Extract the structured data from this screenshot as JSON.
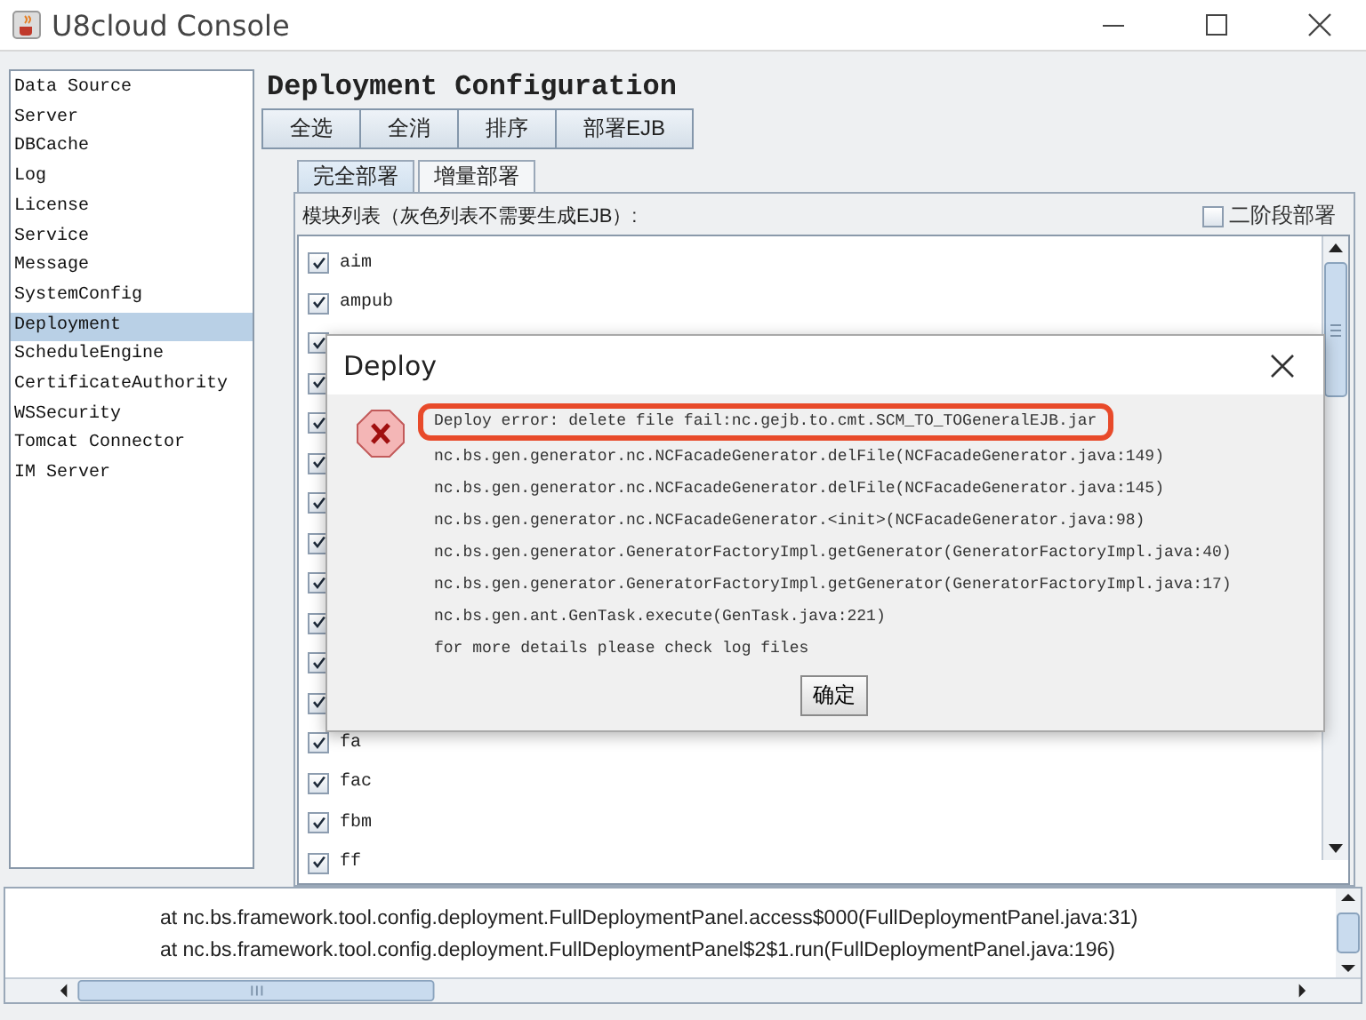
{
  "window": {
    "title": "U8cloud Console"
  },
  "sidebar": {
    "items": [
      {
        "label": "Data Source",
        "selected": false
      },
      {
        "label": "Server",
        "selected": false
      },
      {
        "label": "DBCache",
        "selected": false
      },
      {
        "label": "Log",
        "selected": false
      },
      {
        "label": "License",
        "selected": false
      },
      {
        "label": "Service",
        "selected": false
      },
      {
        "label": "Message",
        "selected": false
      },
      {
        "label": "SystemConfig",
        "selected": false
      },
      {
        "label": "Deployment",
        "selected": true
      },
      {
        "label": "ScheduleEngine",
        "selected": false
      },
      {
        "label": "CertificateAuthority",
        "selected": false
      },
      {
        "label": "WSSecurity",
        "selected": false
      },
      {
        "label": "Tomcat Connector",
        "selected": false
      },
      {
        "label": "IM Server",
        "selected": false
      }
    ]
  },
  "heading": "Deployment Configuration",
  "toolbar": [
    "全选",
    "全消",
    "排序",
    "部署EJB"
  ],
  "tabs": [
    {
      "label": "完全部署",
      "selected": true
    },
    {
      "label": "增量部署",
      "selected": false
    }
  ],
  "module_list": {
    "label": "模块列表（灰色列表不需要生成EJB）:",
    "two_stage": {
      "label": "二阶段部署",
      "checked": false
    },
    "modules": [
      {
        "name": "aim",
        "checked": true
      },
      {
        "name": "ampub",
        "checked": true
      },
      {
        "checked": true
      },
      {
        "checked": true
      },
      {
        "checked": true
      },
      {
        "checked": true
      },
      {
        "checked": true
      },
      {
        "checked": true
      },
      {
        "checked": true
      },
      {
        "checked": true
      },
      {
        "checked": true
      },
      {
        "checked": true
      },
      {
        "name": "fa",
        "checked": true
      },
      {
        "name": "fac",
        "checked": true
      },
      {
        "name": "fbm",
        "checked": true
      },
      {
        "name": "ff",
        "checked": true
      }
    ]
  },
  "log": [
    "at nc.bs.framework.tool.config.deployment.FullDeploymentPanel.access$000(FullDeploymentPanel.java:31)",
    "at nc.bs.framework.tool.config.deployment.FullDeploymentPanel$2$1.run(FullDeploymentPanel.java:196)"
  ],
  "dialog": {
    "title": "Deploy",
    "lines": [
      {
        "text": "Deploy error: delete file fail:nc.gejb.to.cmt.SCM_TO_TOGeneralEJB.jar",
        "highlighted": true
      },
      {
        "text": "nc.bs.gen.generator.nc.NCFacadeGenerator.delFile(NCFacadeGenerator.java:149)",
        "highlighted": false
      },
      {
        "text": "nc.bs.gen.generator.nc.NCFacadeGenerator.delFile(NCFacadeGenerator.java:145)",
        "highlighted": false
      },
      {
        "text": "nc.bs.gen.generator.nc.NCFacadeGenerator.<init>(NCFacadeGenerator.java:98)",
        "highlighted": false
      },
      {
        "text": "nc.bs.gen.generator.GeneratorFactoryImpl.getGenerator(GeneratorFactoryImpl.java:40)",
        "highlighted": false
      },
      {
        "text": "nc.bs.gen.generator.GeneratorFactoryImpl.getGenerator(GeneratorFactoryImpl.java:17)",
        "highlighted": false
      },
      {
        "text": "nc.bs.gen.ant.GenTask.execute(GenTask.java:221)",
        "highlighted": false
      },
      {
        "text": "for more details please check log files",
        "highlighted": false
      }
    ],
    "ok_button": "确定"
  }
}
